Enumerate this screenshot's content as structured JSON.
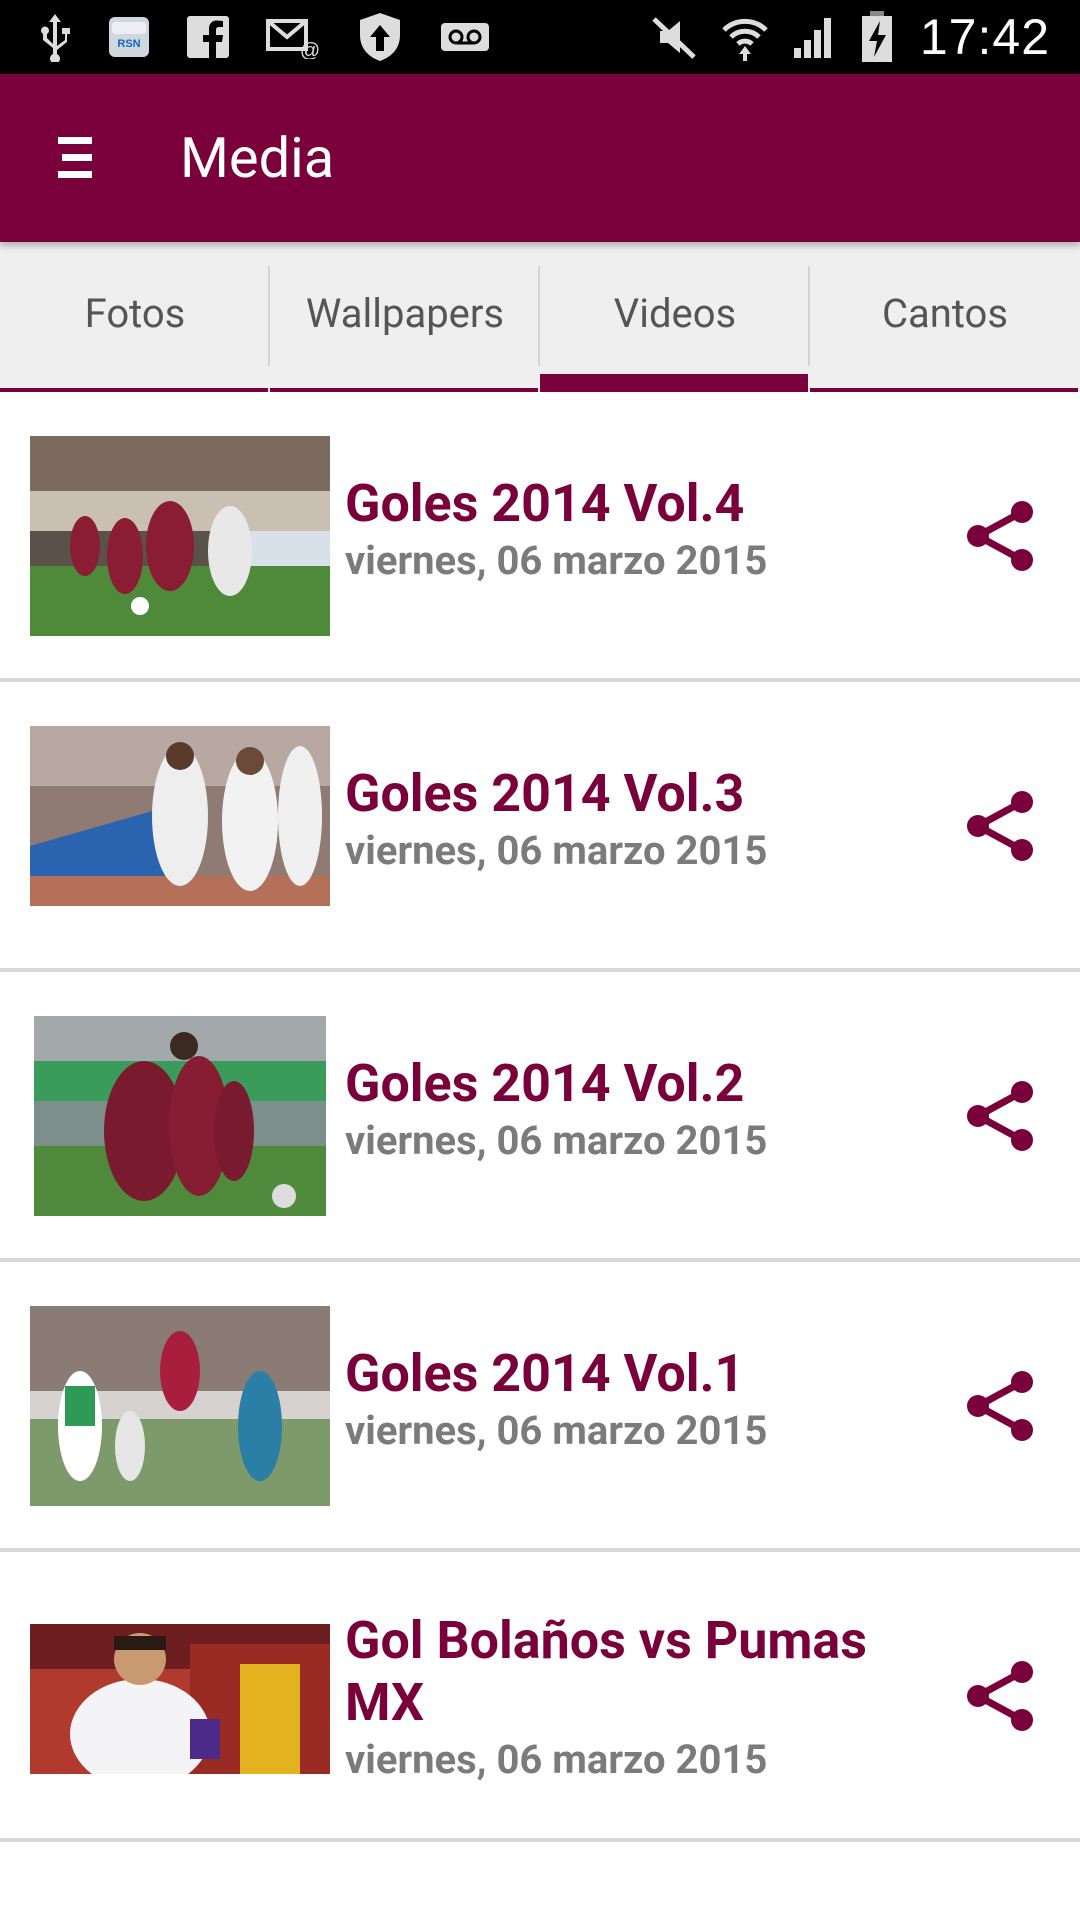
{
  "status_bar": {
    "time": "17:42",
    "left_icons": [
      "usb-icon",
      "rsn-app-icon",
      "facebook-icon",
      "email-icon",
      "shield-update-icon",
      "voicemail-icon"
    ],
    "right_icons": [
      "mute-icon",
      "wifi-icon",
      "signal-icon",
      "battery-charging-icon"
    ]
  },
  "app_bar": {
    "title": "Media"
  },
  "tabs": [
    {
      "label": "Fotos",
      "active": false
    },
    {
      "label": "Wallpapers",
      "active": false
    },
    {
      "label": "Videos",
      "active": true
    },
    {
      "label": "Cantos",
      "active": false
    }
  ],
  "videos": [
    {
      "title": "Goles 2014 Vol.4",
      "date": "viernes, 06 marzo 2015"
    },
    {
      "title": "Goles 2014 Vol.3",
      "date": "viernes, 06 marzo 2015"
    },
    {
      "title": "Goles 2014 Vol.2",
      "date": "viernes, 06 marzo 2015"
    },
    {
      "title": "Goles 2014 Vol.1",
      "date": "viernes, 06 marzo 2015"
    },
    {
      "title": "Gol Bolaños vs Pumas MX",
      "date": "viernes, 06 marzo 2015"
    }
  ],
  "colors": {
    "brand": "#7a003c",
    "tab_background": "#efefef",
    "date_text": "#7b7b7b"
  }
}
